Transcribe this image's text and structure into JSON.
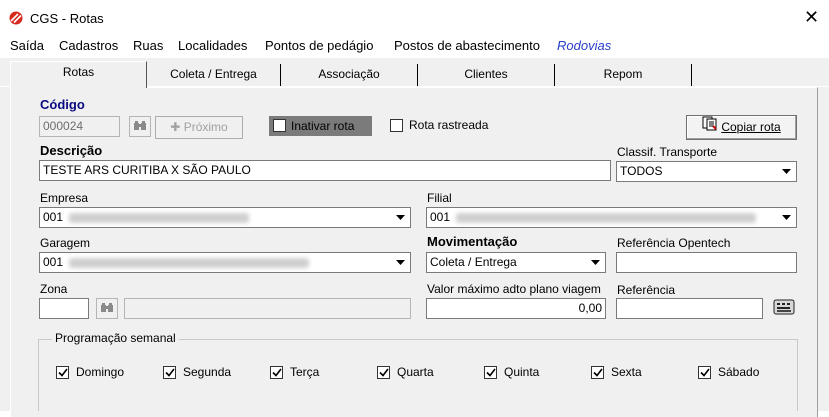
{
  "window": {
    "title": "CGS - Rotas",
    "close_glyph": "✕",
    "logo_icon": "cgs-logo-icon"
  },
  "menu": [
    {
      "label": "Saída"
    },
    {
      "label": "Cadastros"
    },
    {
      "label": "Ruas"
    },
    {
      "label": "Localidades"
    },
    {
      "label": "Pontos de pedágio"
    },
    {
      "label": "Postos de abastecimento"
    },
    {
      "label": "Rodovias"
    }
  ],
  "tabs": [
    {
      "label": "Rotas",
      "active": true
    },
    {
      "label": "Coleta / Entrega"
    },
    {
      "label": "Associação"
    },
    {
      "label": "Clientes"
    },
    {
      "label": "Repom"
    }
  ],
  "form": {
    "codigo_label": "Código",
    "codigo_value": "000024",
    "proximo_label": "Próximo",
    "inativar_label": "Inativar rota",
    "rastreada_label": "Rota rastreada",
    "copiar_label": "Copiar rota",
    "descricao_label": "Descrição",
    "descricao_value": "TESTE ARS CURITIBA X SÃO PAULO",
    "classif_label": "Classif. Transporte",
    "classif_value": "TODOS",
    "empresa_label": "Empresa",
    "empresa_value": "001",
    "filial_label": "Filial",
    "filial_value": "001",
    "garagem_label": "Garagem",
    "garagem_value": "001",
    "movimentacao_label": "Movimentação",
    "movimentacao_value": "Coleta / Entrega",
    "ref_opentech_label": "Referência Opentech",
    "ref_opentech_value": "",
    "zona_label": "Zona",
    "zona_value": "",
    "valor_label": "Valor máximo adto plano viagem",
    "valor_value": "0,00",
    "referencia_label": "Referência",
    "referencia_value": ""
  },
  "programacao": {
    "legend": "Programação semanal",
    "days": [
      {
        "label": "Domingo",
        "checked": true
      },
      {
        "label": "Segunda",
        "checked": true
      },
      {
        "label": "Terça",
        "checked": true
      },
      {
        "label": "Quarta",
        "checked": true
      },
      {
        "label": "Quinta",
        "checked": true
      },
      {
        "label": "Sexta",
        "checked": true
      },
      {
        "label": "Sábado",
        "checked": true
      }
    ]
  },
  "colors": {
    "menu_special": "#2a3fcc",
    "label_navy": "#0a0a80",
    "panel_bg": "#f0f0f0"
  }
}
